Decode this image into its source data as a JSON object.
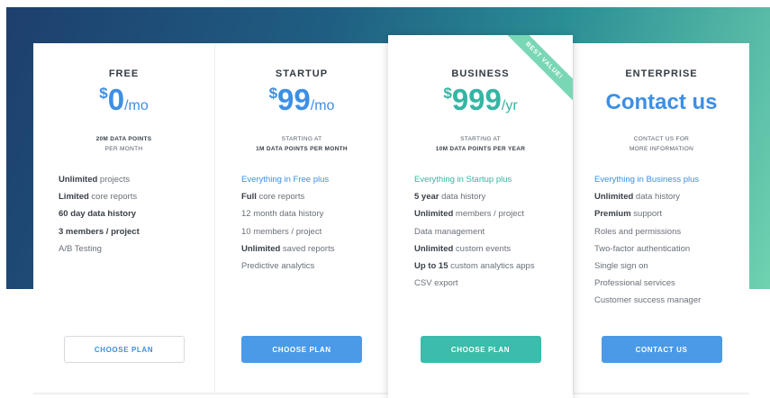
{
  "plans": [
    {
      "name": "FREE",
      "currency": "$",
      "amount": "0",
      "period": "/mo",
      "sub_line1": "20M DATA POINTS",
      "sub_line2": "PER MONTH",
      "features": [
        {
          "bold": "Unlimited",
          "rest": " projects"
        },
        {
          "bold": "Limited",
          "rest": " core reports"
        },
        {
          "bold": "60 day data history",
          "rest": ""
        },
        {
          "bold": "3 members / project",
          "rest": ""
        },
        {
          "bold": "",
          "rest": "A/B Testing"
        }
      ],
      "button": "CHOOSE PLAN"
    },
    {
      "name": "STARTUP",
      "currency": "$",
      "amount": "99",
      "period": "/mo",
      "sub_line1": "STARTING AT",
      "sub_line2": "1M DATA POINTS PER MONTH",
      "highlight": {
        "text": "Everything in Free",
        "suffix": " plus"
      },
      "features": [
        {
          "bold": "Full",
          "rest": " core reports"
        },
        {
          "bold": "",
          "rest": "12 month data history"
        },
        {
          "bold": "",
          "rest": "10 members / project"
        },
        {
          "bold": "Unlimited",
          "rest": " saved reports"
        },
        {
          "bold": "",
          "rest": "Predictive analytics"
        }
      ],
      "button": "CHOOSE PLAN"
    },
    {
      "name": "BUSINESS",
      "currency": "$",
      "amount": "999",
      "period": "/yr",
      "ribbon": "BEST VALUE!",
      "sub_line1": "STARTING AT",
      "sub_line2": "10M DATA POINTS PER YEAR",
      "highlight": {
        "text": "Everything in Startup",
        "suffix": " plus"
      },
      "features": [
        {
          "bold": "5 year",
          "rest": " data history"
        },
        {
          "bold": "Unlimited",
          "rest": " members / project"
        },
        {
          "bold": "",
          "rest": "Data management"
        },
        {
          "bold": "Unlimited",
          "rest": " custom events"
        },
        {
          "bold": "Up to 15",
          "rest": " custom analytics apps"
        },
        {
          "bold": "",
          "rest": "CSV export"
        }
      ],
      "button": "CHOOSE PLAN"
    },
    {
      "name": "ENTERPRISE",
      "price_text": "Contact us",
      "sub_line1": "CONTACT US FOR",
      "sub_line2": "MORE INFORMATION",
      "highlight": {
        "text": "Everything in Business",
        "suffix": " plus"
      },
      "features": [
        {
          "bold": "Unlimited",
          "rest": " data history"
        },
        {
          "bold": "Premium",
          "rest": " support"
        },
        {
          "bold": "",
          "rest": "Roles and permissions"
        },
        {
          "bold": "",
          "rest": "Two-factor authentication"
        },
        {
          "bold": "",
          "rest": "Single sign on"
        },
        {
          "bold": "",
          "rest": "Professional services"
        },
        {
          "bold": "",
          "rest": "Customer success manager"
        }
      ],
      "button": "CONTACT US"
    }
  ],
  "colors": {
    "accent_blue": "#3d8fe4",
    "accent_teal": "#35b5a3",
    "button_blue": "#4a9ae8",
    "button_teal": "#3cbcaa",
    "ribbon": "#7ad7b6",
    "gradient_start": "#1e3f6e",
    "gradient_end": "#6fd2b0"
  }
}
